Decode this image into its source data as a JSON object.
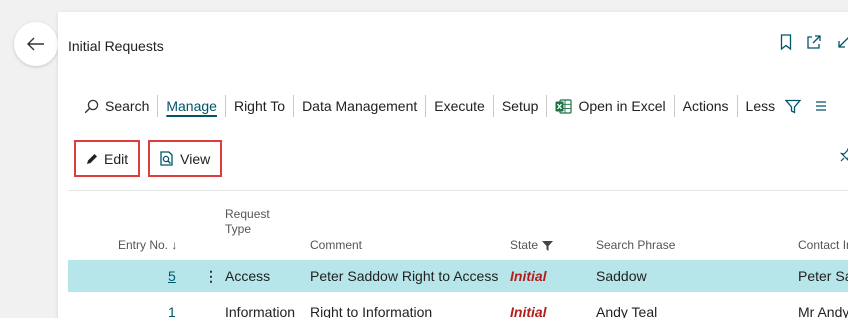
{
  "page": {
    "title": "Initial Requests"
  },
  "actionbar": {
    "items": [
      {
        "label": "Search",
        "icon": "search-icon"
      },
      {
        "label": "Manage",
        "active": true
      },
      {
        "label": "Right To"
      },
      {
        "label": "Data Management"
      },
      {
        "label": "Execute"
      },
      {
        "label": "Setup"
      },
      {
        "label": "Open in Excel",
        "icon": "excel-icon"
      },
      {
        "label": "Actions"
      },
      {
        "label": "Less"
      }
    ]
  },
  "subbar": {
    "edit_label": "Edit",
    "view_label": "View"
  },
  "grid": {
    "headers": {
      "entry_no": "Entry No. ↓",
      "request_type": "Request Type",
      "comment": "Comment",
      "state": "State",
      "search_phrase": "Search Phrase",
      "contact": "Contact In"
    },
    "rows": [
      {
        "entry_no": "5",
        "request_type": "Access",
        "comment": "Peter Saddow Right to Access",
        "state": "Initial",
        "search_phrase": "Saddow",
        "contact": "Peter Saf"
      },
      {
        "entry_no": "1",
        "request_type": "Information",
        "comment": "Right to Information",
        "state": "Initial",
        "search_phrase": "Andy Teal",
        "contact": "Mr Andy"
      }
    ]
  },
  "colors": {
    "accent": "#00556a",
    "selected_row": "#b6e6ea",
    "state_initial": "#b51d1d",
    "highlight_box": "#e03c3c",
    "excel": "#1d7044"
  }
}
